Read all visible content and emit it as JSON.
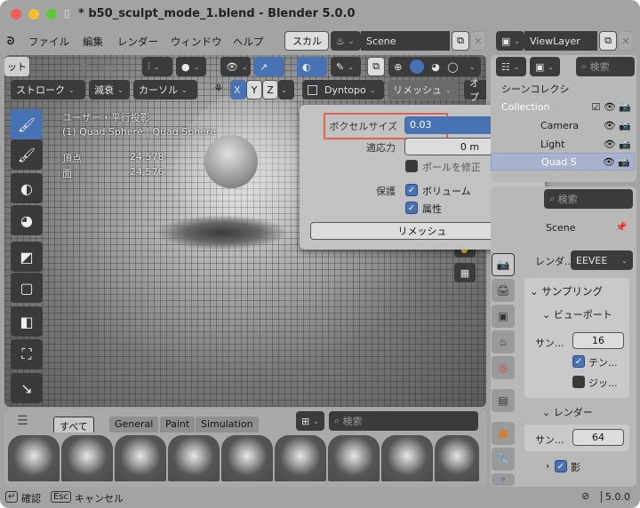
{
  "window": {
    "title": "* b50_sculpt_mode_1.blend - Blender 5.0.0"
  },
  "menubar": {
    "items": [
      "ファイル",
      "編集",
      "レンダー",
      "ウィンドウ",
      "ヘルプ"
    ],
    "workspace_tab": "スカル",
    "scene": "Scene",
    "view_layer": "ViewLayer"
  },
  "viewport_header": {
    "row1_left": "ット",
    "color_attr": "カラー属性",
    "stroke": "ストローク",
    "falloff": "減衰",
    "cursor": "カーソル",
    "x": "X",
    "y": "Y",
    "z": "Z",
    "dyntopo": "Dyntopo",
    "remesh": "リメッシュ",
    "options": "オプ"
  },
  "overlay": {
    "view": "ユーザー・平行投影",
    "object": "(1) Quad Sphere | Quad Sphere",
    "vertices_label": "頂点",
    "vertices": "24,578",
    "faces_label": "面",
    "faces": "24,576"
  },
  "remesh_popover": {
    "voxel_size_label": "ボクセルサイズ",
    "voxel_size": "0.03",
    "adaptivity_label": "適応力",
    "adaptivity": "0 m",
    "fix_poles": "ポールを修正",
    "fix_poles_checked": false,
    "preserve_label": "保護",
    "volume": "ボリューム",
    "volume_checked": true,
    "attributes": "属性",
    "attributes_checked": true,
    "remesh_button": "リメッシュ"
  },
  "outliner": {
    "search_placeholder": "検索",
    "title": "シーンコレクシ",
    "items": [
      "Collection",
      "Camera",
      "Light",
      "Quad S"
    ]
  },
  "properties": {
    "search_placeholder": "検索",
    "scene": "Scene",
    "render_engine_label": "レンダ...",
    "render_engine": "EEVEE",
    "sampling": "サンプリング",
    "viewport": "ビューポート",
    "viewport_samples_label": "サン...",
    "viewport_samples": "16",
    "temporal": "テン...",
    "temporal_checked": true,
    "jitter": "ジッ...",
    "jitter_checked": false,
    "render": "レンダー",
    "render_samples_label": "サン...",
    "render_samples": "64",
    "shadows": "影",
    "shadows_checked": true
  },
  "asset_shelf": {
    "tabs": [
      "すべて",
      "General",
      "Paint",
      "Simulation"
    ],
    "search_placeholder": "検索"
  },
  "statusbar": {
    "confirm_key": "↵",
    "confirm": "確認",
    "cancel_key": "Esc",
    "cancel": "キャンセル",
    "version": "5.0.0"
  },
  "colors": {
    "accent": "#4772b3",
    "highlight": "#e8604a"
  }
}
